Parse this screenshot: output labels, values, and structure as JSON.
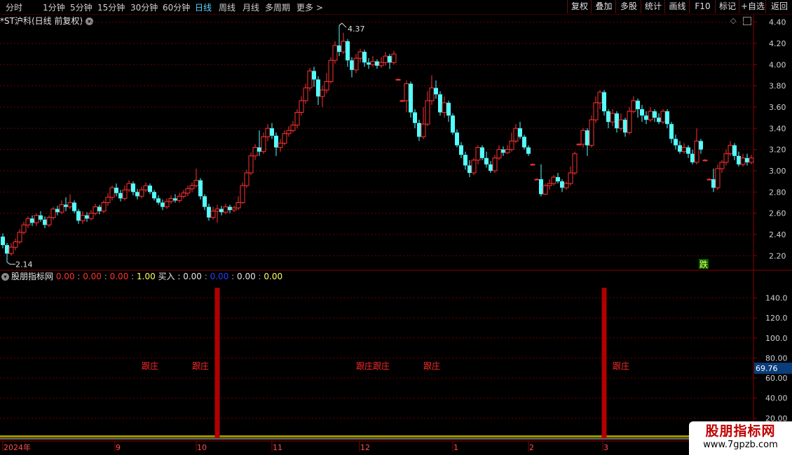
{
  "toolbar": {
    "periods": [
      "分时",
      "1分钟",
      "5分钟",
      "15分钟",
      "30分钟",
      "60分钟",
      "日线",
      "周线",
      "月线",
      "多周期",
      "更多 >"
    ],
    "active_period": "日线",
    "buttons": [
      "复权",
      "叠加",
      "多股",
      "统计",
      "画线",
      "F10",
      "标记",
      "+自选",
      "返回"
    ]
  },
  "chart_header": {
    "title": "*ST沪科(日线 前复权)"
  },
  "price_axis": {
    "ticks": [
      "4.40",
      "4.20",
      "4.00",
      "3.80",
      "3.60",
      "3.40",
      "3.20",
      "3.00",
      "2.80",
      "2.60",
      "2.40",
      "2.20"
    ]
  },
  "annotations": {
    "high": "4.37",
    "low": "2.14",
    "signal": "跌"
  },
  "indicator": {
    "name": "股朋指标网",
    "values": [
      "0.00",
      "0.00",
      "0.00",
      "1.00"
    ],
    "buy_label": "买入",
    "buy_values": [
      "0.00",
      "0.00",
      "0.00",
      "0.00"
    ],
    "axis_ticks": [
      "140.0",
      "120.0",
      "100.0",
      "80.00",
      "60.00",
      "40.00",
      "20.00"
    ],
    "current_value": "69.76",
    "follow_label": "跟庄"
  },
  "date_axis": {
    "labels": [
      "2024年",
      "9",
      "10",
      "11",
      "12",
      "1",
      "2",
      "3"
    ]
  },
  "watermark": {
    "title": "股朋指标网",
    "url": "www.7gpzb.com"
  },
  "colors": {
    "up": "#ff3232",
    "down": "#54ffff",
    "bg": "#000000",
    "grid": "#6b0000",
    "bar": "#b00000"
  },
  "chart_data": {
    "type": "candlestick",
    "title": "*ST沪科(日线 前复权)",
    "ylim": [
      2.07,
      4.47
    ],
    "candles": [
      [
        2.38,
        2.3,
        2.41,
        2.27
      ],
      [
        2.3,
        2.22,
        2.32,
        2.14
      ],
      [
        2.22,
        2.28,
        2.32,
        2.2
      ],
      [
        2.28,
        2.33,
        2.36,
        2.25
      ],
      [
        2.33,
        2.42,
        2.45,
        2.31
      ],
      [
        2.42,
        2.49,
        2.52,
        2.4
      ],
      [
        2.49,
        2.55,
        2.57,
        2.46
      ],
      [
        2.55,
        2.51,
        2.58,
        2.48
      ],
      [
        2.51,
        2.58,
        2.6,
        2.48
      ],
      [
        2.58,
        2.54,
        2.62,
        2.52
      ],
      [
        2.54,
        2.49,
        2.57,
        2.46
      ],
      [
        2.49,
        2.56,
        2.58,
        2.47
      ],
      [
        2.56,
        2.64,
        2.66,
        2.54
      ],
      [
        2.64,
        2.61,
        2.67,
        2.58
      ],
      [
        2.61,
        2.68,
        2.72,
        2.59
      ],
      [
        2.68,
        2.66,
        2.75,
        2.62
      ],
      [
        2.66,
        2.7,
        2.78,
        2.64
      ],
      [
        2.7,
        2.62,
        2.72,
        2.6
      ],
      [
        2.62,
        2.53,
        2.64,
        2.5
      ],
      [
        2.53,
        2.58,
        2.62,
        2.5
      ],
      [
        2.58,
        2.55,
        2.61,
        2.52
      ],
      [
        2.55,
        2.6,
        2.63,
        2.53
      ],
      [
        2.6,
        2.66,
        2.69,
        2.58
      ],
      [
        2.66,
        2.62,
        2.68,
        2.59
      ],
      [
        2.62,
        2.7,
        2.72,
        2.6
      ],
      [
        2.7,
        2.75,
        2.79,
        2.67
      ],
      [
        2.75,
        2.84,
        2.86,
        2.72
      ],
      [
        2.84,
        2.79,
        2.88,
        2.76
      ],
      [
        2.79,
        2.74,
        2.82,
        2.71
      ],
      [
        2.74,
        2.82,
        2.86,
        2.72
      ],
      [
        2.82,
        2.88,
        2.91,
        2.8
      ],
      [
        2.88,
        2.8,
        2.9,
        2.77
      ],
      [
        2.8,
        2.76,
        2.83,
        2.73
      ],
      [
        2.76,
        2.82,
        2.85,
        2.74
      ],
      [
        2.82,
        2.86,
        2.89,
        2.8
      ],
      [
        2.86,
        2.8,
        2.88,
        2.78
      ],
      [
        2.8,
        2.74,
        2.82,
        2.72
      ],
      [
        2.74,
        2.7,
        2.77,
        2.68
      ],
      [
        2.7,
        2.66,
        2.73,
        2.63
      ],
      [
        2.66,
        2.71,
        2.74,
        2.64
      ],
      [
        2.71,
        2.74,
        2.77,
        2.69
      ],
      [
        2.74,
        2.72,
        2.78,
        2.7
      ],
      [
        2.72,
        2.76,
        2.79,
        2.7
      ],
      [
        2.76,
        2.79,
        2.82,
        2.74
      ],
      [
        2.79,
        2.83,
        2.86,
        2.76
      ],
      [
        2.83,
        2.86,
        2.89,
        2.8
      ],
      [
        2.86,
        2.91,
        3.02,
        2.84
      ],
      [
        2.91,
        2.76,
        2.93,
        2.73
      ],
      [
        2.76,
        2.66,
        2.78,
        2.63
      ],
      [
        2.66,
        2.56,
        2.69,
        2.53
      ],
      [
        2.56,
        2.62,
        2.66,
        2.54
      ],
      [
        2.62,
        2.64,
        2.68,
        2.51
      ],
      [
        2.64,
        2.61,
        2.67,
        2.58
      ],
      [
        2.61,
        2.66,
        2.69,
        2.59
      ],
      [
        2.66,
        2.63,
        2.68,
        2.6
      ],
      [
        2.63,
        2.65,
        2.67,
        2.61
      ],
      [
        2.65,
        2.7,
        2.76,
        2.63
      ],
      [
        2.7,
        2.86,
        2.89,
        2.69
      ],
      [
        2.86,
        2.98,
        3.01,
        2.84
      ],
      [
        2.98,
        3.14,
        3.17,
        2.96
      ],
      [
        3.14,
        3.22,
        3.25,
        3.1
      ],
      [
        3.22,
        3.18,
        3.38,
        3.14
      ],
      [
        3.18,
        3.32,
        3.36,
        3.16
      ],
      [
        3.32,
        3.4,
        3.44,
        3.28
      ],
      [
        3.4,
        3.33,
        3.45,
        3.3
      ],
      [
        3.33,
        3.22,
        3.36,
        3.14
      ],
      [
        3.22,
        3.26,
        3.3,
        3.18
      ],
      [
        3.26,
        3.35,
        3.38,
        3.24
      ],
      [
        3.35,
        3.38,
        3.42,
        3.32
      ],
      [
        3.38,
        3.43,
        3.47,
        3.36
      ],
      [
        3.43,
        3.55,
        3.58,
        3.4
      ],
      [
        3.55,
        3.66,
        3.7,
        3.52
      ],
      [
        3.66,
        3.78,
        3.82,
        3.63
      ],
      [
        3.78,
        3.94,
        3.97,
        3.75
      ],
      [
        3.94,
        3.86,
        3.98,
        3.79
      ],
      [
        3.86,
        3.7,
        3.89,
        3.62
      ],
      [
        3.7,
        3.76,
        3.8,
        3.6
      ],
      [
        3.76,
        3.84,
        3.92,
        3.73
      ],
      [
        3.84,
        4.04,
        4.07,
        3.82
      ],
      [
        4.04,
        4.18,
        4.22,
        4.01
      ],
      [
        4.18,
        4.12,
        4.37,
        4.08
      ],
      [
        4.12,
        4.22,
        4.3,
        4.1
      ],
      [
        4.22,
        4.04,
        4.24,
        3.98
      ],
      [
        4.04,
        3.95,
        4.07,
        3.88
      ],
      [
        3.95,
        4.06,
        4.1,
        3.92
      ],
      [
        4.06,
        4.12,
        4.15,
        4.02
      ],
      [
        4.12,
        4.02,
        4.14,
        3.98
      ],
      [
        4.02,
        4.0,
        4.06,
        3.96
      ],
      [
        4.0,
        4.03,
        4.08,
        3.98
      ],
      [
        4.03,
        3.99,
        4.05,
        3.96
      ],
      [
        3.99,
        4.02,
        4.07,
        3.97
      ],
      [
        4.02,
        4.08,
        4.12,
        3.99
      ],
      [
        4.08,
        4.02,
        4.1,
        3.96
      ],
      [
        4.02,
        4.1,
        4.13,
        4.0
      ],
      [
        3.86,
        3.86,
        3.87,
        3.85
      ],
      [
        3.66,
        3.66,
        3.67,
        3.65
      ],
      [
        3.66,
        3.82,
        3.85,
        3.55
      ],
      [
        3.82,
        3.55,
        3.84,
        3.5
      ],
      [
        3.55,
        3.45,
        3.58,
        3.4
      ],
      [
        3.45,
        3.32,
        3.48,
        3.28
      ],
      [
        3.32,
        3.44,
        3.6,
        3.3
      ],
      [
        3.44,
        3.66,
        3.75,
        3.42
      ],
      [
        3.66,
        3.78,
        3.9,
        3.62
      ],
      [
        3.78,
        3.72,
        3.85,
        3.68
      ],
      [
        3.72,
        3.55,
        3.75,
        3.52
      ],
      [
        3.55,
        3.64,
        3.7,
        3.5
      ],
      [
        3.64,
        3.52,
        3.66,
        3.46
      ],
      [
        3.52,
        3.36,
        3.54,
        3.34
      ],
      [
        3.36,
        3.24,
        3.39,
        3.22
      ],
      [
        3.24,
        3.15,
        3.27,
        3.12
      ],
      [
        3.15,
        3.05,
        3.18,
        3.01
      ],
      [
        3.05,
        2.98,
        3.1,
        2.94
      ],
      [
        2.98,
        3.1,
        3.12,
        2.96
      ],
      [
        3.1,
        3.22,
        3.24,
        3.06
      ],
      [
        3.22,
        3.12,
        3.24,
        3.1
      ],
      [
        3.12,
        3.06,
        3.18,
        3.03
      ],
      [
        3.06,
        3.0,
        3.09,
        2.98
      ],
      [
        3.0,
        3.12,
        3.15,
        2.98
      ],
      [
        3.12,
        3.2,
        3.24,
        3.1
      ],
      [
        3.2,
        3.17,
        3.23,
        3.14
      ],
      [
        3.17,
        3.2,
        3.24,
        3.16
      ],
      [
        3.2,
        3.28,
        3.36,
        3.18
      ],
      [
        3.28,
        3.4,
        3.44,
        3.26
      ],
      [
        3.4,
        3.32,
        3.46,
        3.3
      ],
      [
        3.32,
        3.22,
        3.34,
        3.2
      ],
      [
        3.22,
        3.16,
        3.24,
        3.14
      ],
      [
        3.06,
        3.06,
        3.07,
        3.05
      ],
      [
        2.92,
        2.92,
        2.93,
        2.91
      ],
      [
        2.92,
        2.78,
        3.06,
        2.76
      ],
      [
        2.78,
        2.86,
        2.88,
        2.77
      ],
      [
        2.86,
        2.88,
        2.92,
        2.82
      ],
      [
        2.88,
        2.94,
        2.96,
        2.86
      ],
      [
        2.94,
        2.9,
        2.98,
        2.88
      ],
      [
        2.9,
        2.84,
        2.92,
        2.8
      ],
      [
        2.84,
        2.88,
        2.9,
        2.82
      ],
      [
        2.88,
        2.98,
        3.04,
        2.86
      ],
      [
        2.98,
        3.16,
        3.18,
        2.96
      ],
      [
        3.25,
        3.25,
        3.26,
        3.24
      ],
      [
        3.25,
        3.38,
        3.4,
        3.22
      ],
      [
        3.38,
        3.24,
        3.4,
        3.14
      ],
      [
        3.24,
        3.48,
        3.52,
        3.22
      ],
      [
        3.48,
        3.64,
        3.7,
        3.45
      ],
      [
        3.64,
        3.74,
        3.76,
        3.58
      ],
      [
        3.74,
        3.56,
        3.76,
        3.52
      ],
      [
        3.56,
        3.46,
        3.58,
        3.4
      ],
      [
        3.46,
        3.54,
        3.58,
        3.42
      ],
      [
        3.54,
        3.4,
        3.56,
        3.36
      ],
      [
        3.4,
        3.48,
        3.54,
        3.38
      ],
      [
        3.48,
        3.36,
        3.5,
        3.32
      ],
      [
        3.36,
        3.56,
        3.6,
        3.34
      ],
      [
        3.56,
        3.66,
        3.7,
        3.54
      ],
      [
        3.66,
        3.58,
        3.68,
        3.5
      ],
      [
        3.58,
        3.52,
        3.62,
        3.46
      ],
      [
        3.52,
        3.48,
        3.56,
        3.44
      ],
      [
        3.48,
        3.56,
        3.6,
        3.46
      ],
      [
        3.56,
        3.5,
        3.58,
        3.46
      ],
      [
        3.5,
        3.46,
        3.54,
        3.44
      ],
      [
        3.46,
        3.56,
        3.58,
        3.44
      ],
      [
        3.56,
        3.44,
        3.58,
        3.4
      ],
      [
        3.44,
        3.3,
        3.46,
        3.26
      ],
      [
        3.3,
        3.24,
        3.34,
        3.2
      ],
      [
        3.24,
        3.18,
        3.28,
        3.16
      ],
      [
        3.18,
        3.22,
        3.26,
        3.16
      ],
      [
        3.22,
        3.16,
        3.24,
        3.12
      ],
      [
        3.16,
        3.08,
        3.2,
        3.06
      ],
      [
        3.08,
        3.28,
        3.4,
        3.06
      ],
      [
        3.28,
        3.2,
        3.3,
        3.16
      ],
      [
        3.1,
        3.1,
        3.11,
        3.09
      ],
      [
        2.92,
        2.92,
        2.93,
        2.91
      ],
      [
        2.92,
        2.84,
        3.02,
        2.8
      ],
      [
        2.84,
        3.02,
        3.06,
        2.82
      ],
      [
        3.02,
        3.08,
        3.1,
        2.98
      ],
      [
        3.08,
        3.16,
        3.2,
        3.05
      ],
      [
        3.16,
        3.24,
        3.28,
        3.14
      ],
      [
        3.24,
        3.14,
        3.26,
        3.1
      ],
      [
        3.14,
        3.06,
        3.18,
        3.04
      ],
      [
        3.06,
        3.12,
        3.16,
        3.04
      ],
      [
        3.12,
        3.08,
        3.16,
        3.05
      ],
      [
        3.08,
        3.12,
        3.15,
        3.06
      ]
    ],
    "indicator_spikes": [
      {
        "index": 51,
        "value": 150
      },
      {
        "index": 143,
        "value": 150
      }
    ],
    "follow_markers": [
      35,
      47,
      86,
      90,
      102,
      147
    ],
    "indicator_ylim": [
      0,
      155
    ]
  }
}
